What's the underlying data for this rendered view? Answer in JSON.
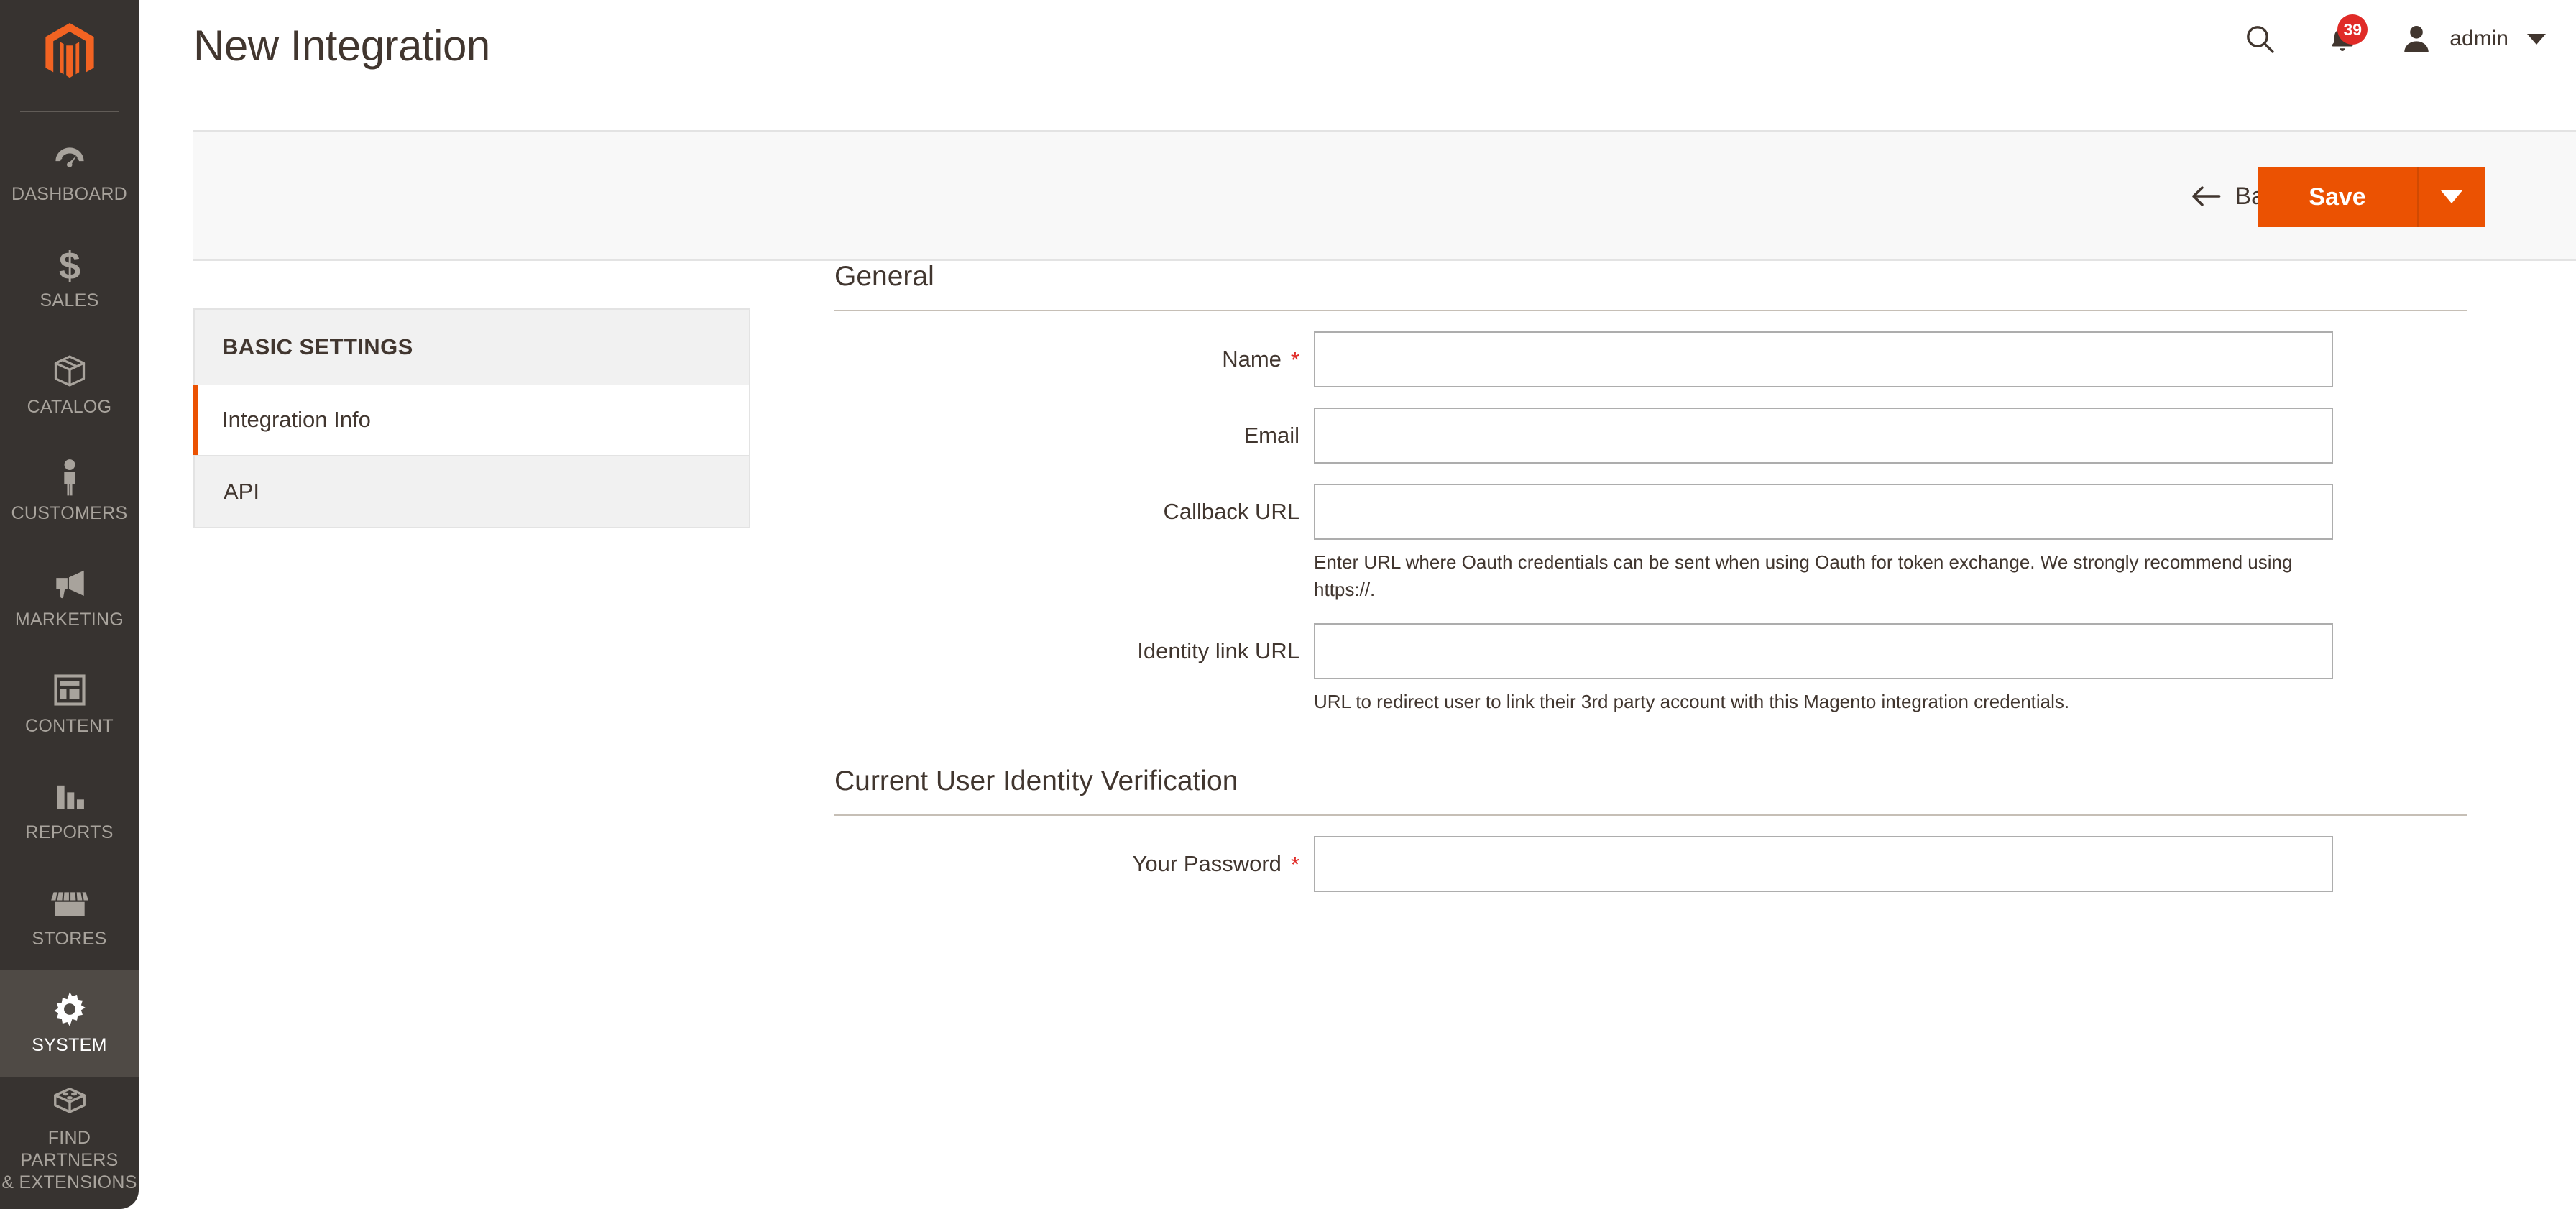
{
  "sidebar": {
    "logo_name": "magento-logo",
    "items": [
      {
        "label": "DASHBOARD",
        "icon": "dashboard-gauge-icon",
        "active": false
      },
      {
        "label": "SALES",
        "icon": "dollar-sign-icon",
        "active": false
      },
      {
        "label": "CATALOG",
        "icon": "box-icon",
        "active": false
      },
      {
        "label": "CUSTOMERS",
        "icon": "person-icon",
        "active": false
      },
      {
        "label": "MARKETING",
        "icon": "megaphone-icon",
        "active": false
      },
      {
        "label": "CONTENT",
        "icon": "layout-grid-icon",
        "active": false
      },
      {
        "label": "REPORTS",
        "icon": "bar-chart-icon",
        "active": false
      },
      {
        "label": "STORES",
        "icon": "storefront-icon",
        "active": false
      },
      {
        "label": "SYSTEM",
        "icon": "gear-icon",
        "active": true
      },
      {
        "label": "FIND PARTNERS\n& EXTENSIONS",
        "icon": "puzzle-block-icon",
        "active": false
      }
    ]
  },
  "header": {
    "title": "New Integration",
    "search_icon": "search-icon",
    "notifications_icon": "bell-icon",
    "notifications_count": "39",
    "avatar_icon": "user-avatar-icon",
    "user_name": "admin",
    "user_caret_icon": "chevron-down-icon"
  },
  "toolbar": {
    "back_label": "Back",
    "back_icon": "arrow-left-icon",
    "save_label": "Save",
    "save_caret_icon": "chevron-down-icon"
  },
  "tabs": {
    "header_label": "BASIC SETTINGS",
    "items": [
      {
        "label": "Integration Info",
        "active": true
      },
      {
        "label": "API",
        "active": false
      }
    ]
  },
  "form": {
    "general": {
      "title": "General",
      "fields": [
        {
          "label": "Name",
          "required": true,
          "value": "",
          "placeholder": "",
          "note": ""
        },
        {
          "label": "Email",
          "required": false,
          "value": "",
          "placeholder": "",
          "note": ""
        },
        {
          "label": "Callback URL",
          "required": false,
          "value": "",
          "placeholder": "",
          "note": "Enter URL where Oauth credentials can be sent when using Oauth for token exchange. We strongly recommend using https://."
        },
        {
          "label": "Identity link URL",
          "required": false,
          "value": "",
          "placeholder": "",
          "note": "URL to redirect user to link their 3rd party account with this Magento integration credentials."
        }
      ]
    },
    "identity": {
      "title": "Current User Identity Verification",
      "fields": [
        {
          "label": "Your Password",
          "required": true,
          "value": "",
          "placeholder": "",
          "note": ""
        }
      ]
    }
  },
  "colors": {
    "brand_orange": "#eb5202",
    "sidebar_bg": "#373330",
    "sidebar_active_bg": "#4f4a45",
    "toolbar_bg": "#f8f8f8",
    "panel_bg": "#f1f1f1",
    "text_dark": "#41362f",
    "required_red": "#e02b27",
    "rule_tan": "#c6bfb6"
  }
}
